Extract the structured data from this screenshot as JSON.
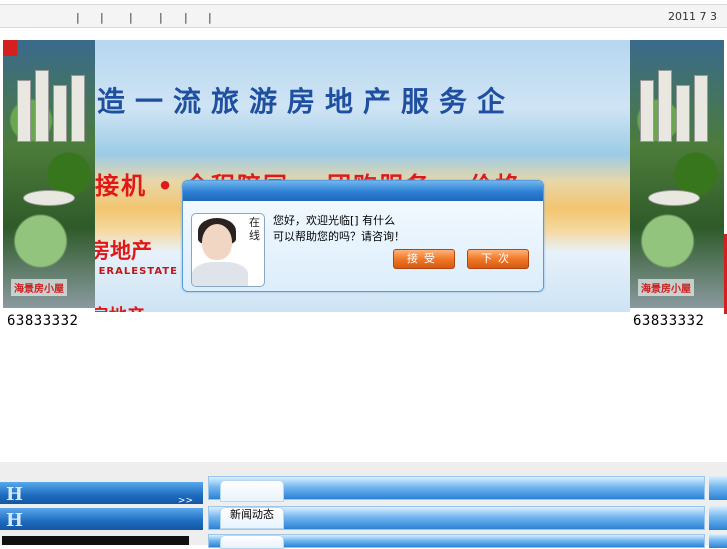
{
  "topbar": {
    "separators": [
      "|",
      "|",
      "|",
      "|",
      "|",
      "|"
    ],
    "date": "2011 7 3"
  },
  "banner": {
    "slogan_main": "造一流旅游房地产服务企",
    "slogan_services": "接机 • 全程陪同 • 团购服务 • 价格",
    "slogan_company": "房地产",
    "slogan_english": "U ERALESTATE",
    "slogan_bottom": "房地产",
    "side_tag": "海景房小屋"
  },
  "phones": {
    "left": "63833332",
    "right": "63833332"
  },
  "popup": {
    "online_label": "在线",
    "message_line1": "您好，欢迎光临[] 有什么",
    "message_line2": "可以帮助您的吗？请咨询！",
    "accept_button": "接受",
    "later_button": "下次"
  },
  "left_panel": {
    "letter1": "H",
    "letter2": "H",
    "more_link": ">>"
  },
  "right_panel": {
    "tab2_label": "新闻动态"
  },
  "colors": {
    "accent_blue": "#1f68b8",
    "popup_button": "#f07828",
    "banner_red": "#e01818"
  }
}
